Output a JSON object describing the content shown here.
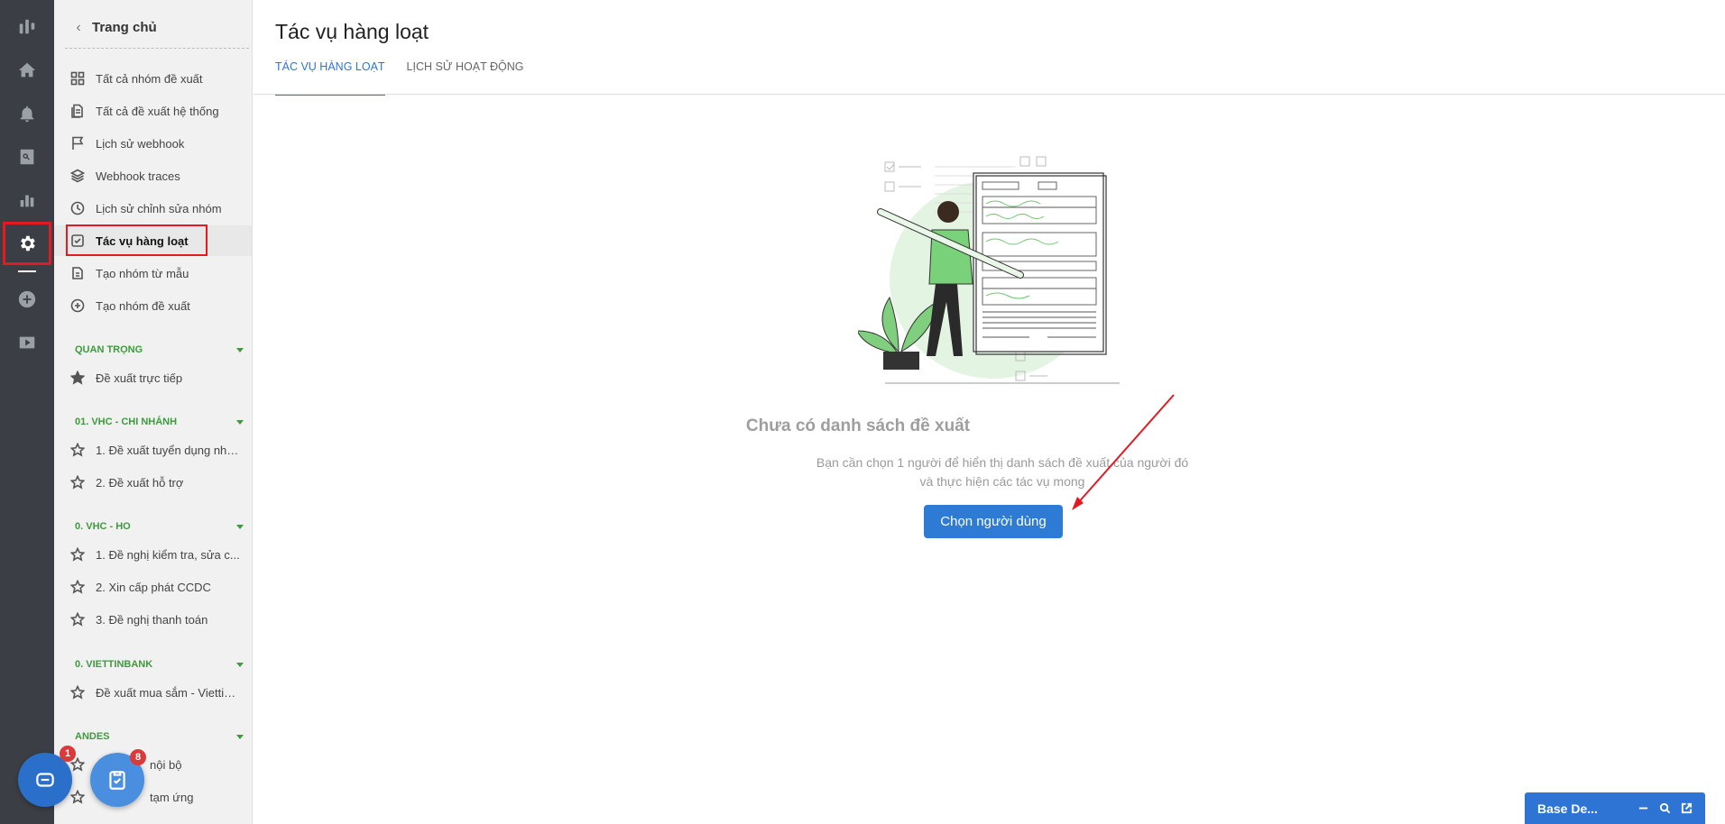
{
  "rail": {
    "items": [
      {
        "icon": "base-logo-icon"
      },
      {
        "icon": "home-icon"
      },
      {
        "icon": "bell-icon"
      },
      {
        "icon": "search-doc-icon"
      },
      {
        "icon": "bar-chart-icon"
      },
      {
        "icon": "gear-icon",
        "active": true
      },
      {
        "icon": "plus-circle-icon"
      },
      {
        "icon": "play-icon"
      }
    ]
  },
  "sidebar": {
    "back_label": "Trang chủ",
    "menu": [
      {
        "label": "Tất cả nhóm đề xuất",
        "icon": "grid-icon"
      },
      {
        "label": "Tất cả đề xuất hệ thống",
        "icon": "documents-icon"
      },
      {
        "label": "Lịch sử webhook",
        "icon": "flag-icon"
      },
      {
        "label": "Webhook traces",
        "icon": "layers-icon"
      },
      {
        "label": "Lịch sử chỉnh sửa nhóm",
        "icon": "clock-icon"
      },
      {
        "label": "Tác vụ hàng loạt",
        "icon": "check-square-icon",
        "active": true
      },
      {
        "label": "Tạo nhóm từ mẫu",
        "icon": "copy-icon"
      },
      {
        "label": "Tạo nhóm đề xuất",
        "icon": "plus-circle-icon"
      }
    ],
    "sections": [
      {
        "title": "QUAN TRỌNG",
        "items": [
          {
            "label": "Đề xuất trực tiếp",
            "filled": true
          }
        ]
      },
      {
        "title": "01. VHC - CHI NHÁNH",
        "items": [
          {
            "label": "1. Đề xuất tuyển dụng nhâ..."
          },
          {
            "label": "2. Đề xuất hỗ trợ"
          }
        ]
      },
      {
        "title": "0. VHC - HO",
        "items": [
          {
            "label": "1. Đề nghị kiểm tra, sửa c..."
          },
          {
            "label": "2. Xin cấp phát CCDC"
          },
          {
            "label": "3. Đề nghị thanh toán"
          }
        ]
      },
      {
        "title": "0. VIETTINBANK",
        "items": [
          {
            "label": "Đề xuất mua sắm - Viettin..."
          }
        ]
      },
      {
        "title": "ANDES",
        "items": [
          {
            "label": "nội bộ"
          },
          {
            "label": "tạm ứng"
          }
        ]
      }
    ]
  },
  "main": {
    "title": "Tác vụ hàng loạt",
    "tabs": [
      {
        "label": "TÁC VỤ HÀNG LOẠT",
        "active": true
      },
      {
        "label": "LỊCH SỬ HOẠT ĐỘNG"
      }
    ],
    "empty_title": "Chưa có danh sách đề xuất",
    "empty_desc_1": "Bạn cần chọn 1 người để hiển thị danh sách đề xuất của người đó",
    "empty_desc_2": "và thực hiện các tác vụ mong",
    "primary_button": "Chọn người dùng"
  },
  "widgets": {
    "chat_badge": "1",
    "task_badge": "8",
    "base_title": "Base De..."
  },
  "colors": {
    "accent": "#2e74d4",
    "highlight": "#e21b23",
    "rail_bg": "#3b3f45",
    "section_green": "#3d9a3d"
  }
}
